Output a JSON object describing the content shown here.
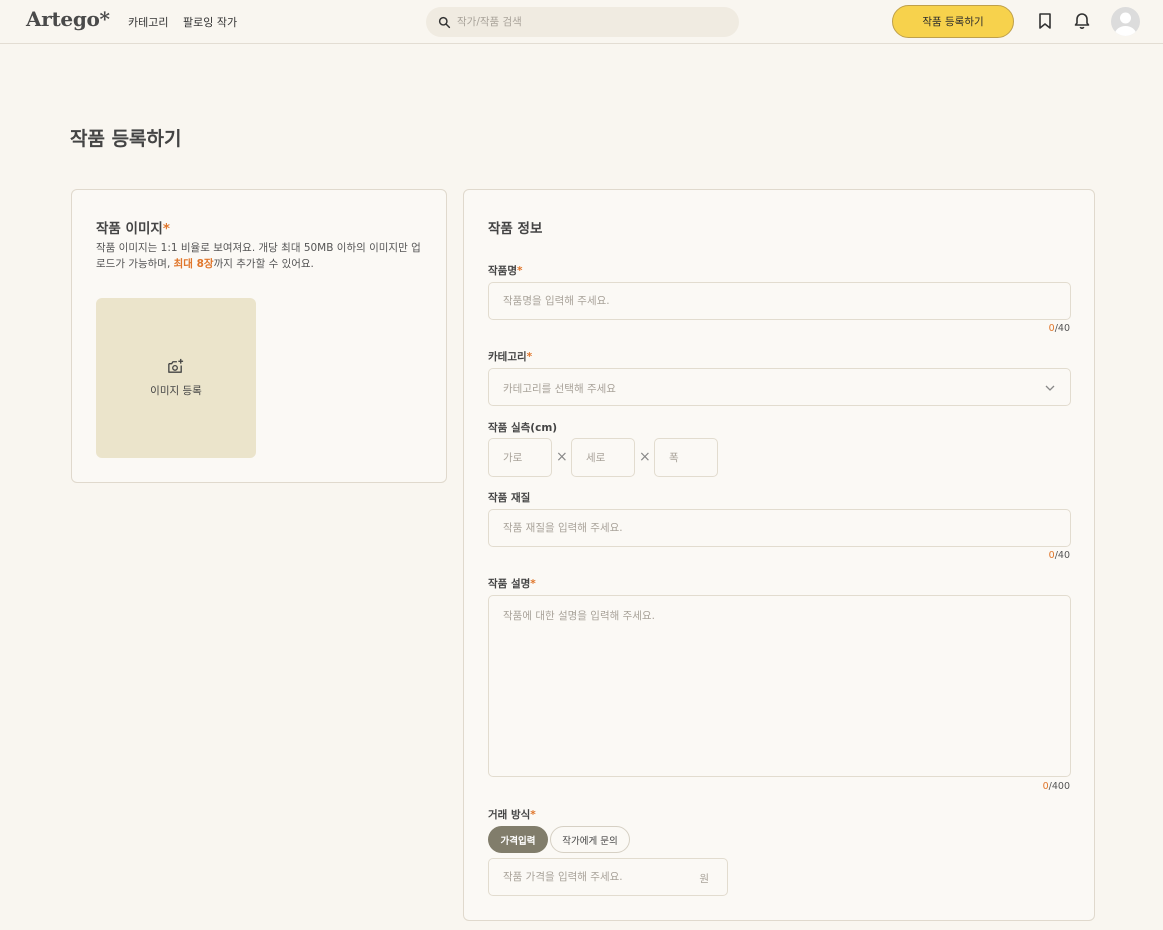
{
  "header": {
    "logo": "Artego*",
    "nav": [
      "카테고리",
      "팔로잉 작가"
    ],
    "search_placeholder": "작가/작품 검색",
    "register_label": "작품 등록하기"
  },
  "page_title": "작품 등록하기",
  "image_section": {
    "title": "작품 이미지",
    "required_mark": "*",
    "desc_before": "작품 이미지는 1:1 비율로 보여져요. 개당 최대 50MB 이하의 이미지만 업로드가 가능하며, ",
    "desc_highlight": "최대 8장",
    "desc_after": "까지 추가할 수 있어요.",
    "upload_label": "이미지 등록"
  },
  "info_section": {
    "title": "작품 정보",
    "name": {
      "label": "작품명",
      "required": "*",
      "placeholder": "작품명을 입력해 주세요.",
      "count": "0",
      "max": "/40"
    },
    "category": {
      "label": "카테고리",
      "required": "*",
      "placeholder": "카테고리를 선택해 주세요"
    },
    "size": {
      "label": "작품 실측(cm)",
      "width_placeholder": "가로",
      "height_placeholder": "세로",
      "depth_placeholder": "폭",
      "times": "×"
    },
    "material": {
      "label": "작품 재질",
      "placeholder": "작품 재질을 입력해 주세요.",
      "count": "0",
      "max": "/40"
    },
    "description": {
      "label": "작품 설명",
      "required": "*",
      "placeholder": "작품에 대한 설명을 입력해 주세요.",
      "count": "0",
      "max": "/400"
    },
    "trade": {
      "label": "거래 방식",
      "required": "*",
      "options": [
        "가격입력",
        "작가에게 문의"
      ],
      "selected": "가격입력",
      "price_placeholder": "작품 가격을 입력해 주세요.",
      "unit": "원"
    }
  },
  "colors": {
    "background": "#f9f6f0",
    "accent": "#f7d24c",
    "required": "#e0762b",
    "upload_bg": "#ebe4cb",
    "active_pill": "#817d6b"
  }
}
